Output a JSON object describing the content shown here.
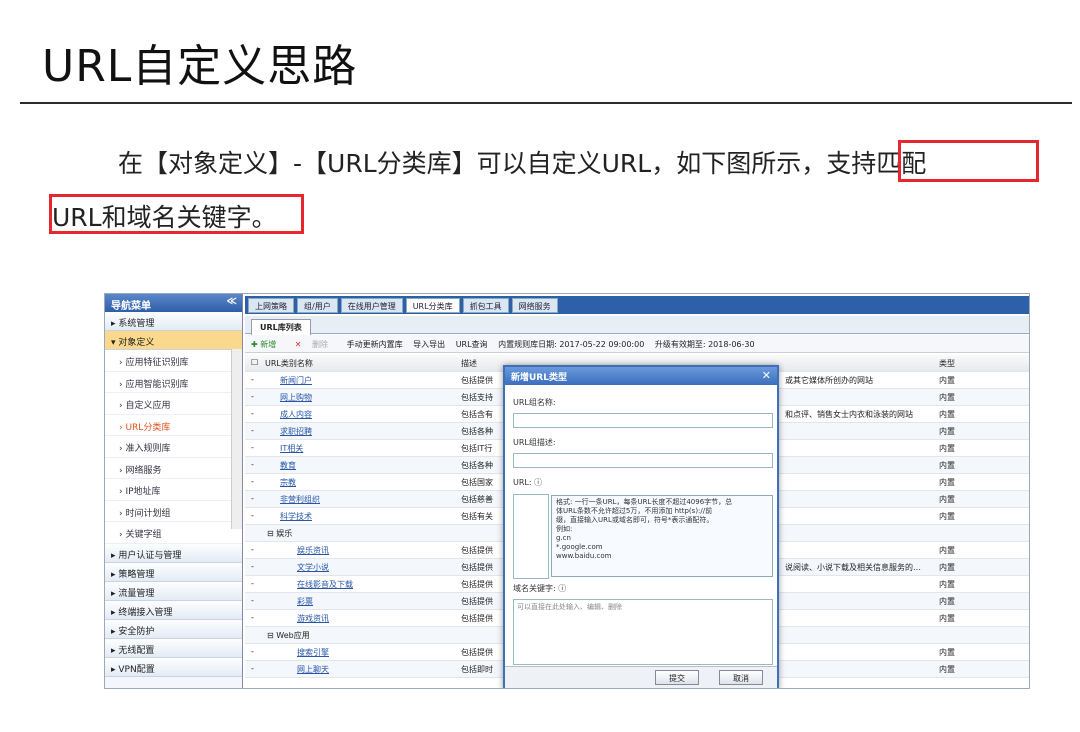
{
  "slide": {
    "title": "URL自定义思路",
    "line1": "在【对象定义】-【URL分类库】可以自定义URL，如下图所示，",
    "line1_hl": "支持匹配",
    "line2": "URL和域名关键字。",
    "accent": "#e8262e"
  },
  "nav": {
    "header": "导航菜单",
    "collapse": "≪",
    "sections_top": [
      "系统管理",
      "对象定义"
    ],
    "items": [
      "应用特征识别库",
      "应用智能识别库",
      "自定义应用",
      "URL分类库",
      "准入规则库",
      "网络服务",
      "IP地址库",
      "时间计划组",
      "关键字组"
    ],
    "sections_bottom": [
      "用户认证与管理",
      "策略管理",
      "流量管理",
      "终端接入管理",
      "安全防护",
      "无线配置",
      "VPN配置"
    ]
  },
  "tabs": [
    "上网策略",
    "组/用户",
    "在线用户管理",
    "URL分类库",
    "抓包工具",
    "网络服务"
  ],
  "subtab": "URL库列表",
  "toolbar": {
    "add": "新增",
    "del": "删除",
    "update": "手动更新内置库",
    "io": "导入导出",
    "query": "URL查询",
    "date": "内置规则库日期: 2017-05-22 09:00:00",
    "expire": "升级有效期至: 2018-06-30"
  },
  "grid": {
    "headers": {
      "name": "URL类别名称",
      "desc": "描述",
      "type": "类型"
    },
    "rows": [
      {
        "name": "新闻门户",
        "desc": "包括提供",
        "right": "或其它媒体所创办的网站",
        "type": "内置"
      },
      {
        "name": "网上购物",
        "desc": "包括支持",
        "right": "",
        "type": "内置"
      },
      {
        "name": "成人内容",
        "desc": "包括含有",
        "right": "和点评、销售女士内衣和泳装的网站",
        "type": "内置"
      },
      {
        "name": "求职招聘",
        "desc": "包括各种",
        "right": "",
        "type": "内置"
      },
      {
        "name": "IT相关",
        "desc": "包括IT行",
        "right": "",
        "type": "内置"
      },
      {
        "name": "教育",
        "desc": "包括各种",
        "right": "",
        "type": "内置"
      },
      {
        "name": "宗教",
        "desc": "包括国家",
        "right": "",
        "type": "内置"
      },
      {
        "name": "非营利组织",
        "desc": "包括慈善",
        "right": "",
        "type": "内置"
      },
      {
        "name": "科学技术",
        "desc": "包括有关",
        "right": "",
        "type": "内置"
      }
    ],
    "group1": "娱乐",
    "rows2": [
      {
        "name": "娱乐资讯",
        "desc": "包括提供",
        "right": "",
        "type": "内置"
      },
      {
        "name": "文学小说",
        "desc": "包括提供",
        "right": "说阅读、小说下载及相关信息服务的…",
        "type": "内置"
      },
      {
        "name": "在线影音及下载",
        "desc": "包括提供",
        "right": "",
        "type": "内置"
      },
      {
        "name": "彩票",
        "desc": "包括提供",
        "right": "",
        "type": "内置"
      },
      {
        "name": "游戏资讯",
        "desc": "包括提供",
        "right": "",
        "type": "内置"
      }
    ],
    "group2": "Web应用",
    "rows3": [
      {
        "name": "搜索引擎",
        "desc": "包括提供",
        "right": "",
        "type": "内置"
      },
      {
        "name": "网上聊天",
        "desc": "包括即时",
        "right": "",
        "type": "内置"
      }
    ]
  },
  "dialog": {
    "title": "新增URL类型",
    "name_label": "URL组名称:",
    "desc_label": "URL组描述:",
    "url_label": "URL: ⓘ",
    "tip_lines": [
      "格式: 一行一条URL，每条URL长度不超过4096字节，总",
      "体URL条数不允许超过5万，不用添加 http(s)://前",
      "缀，直接输入URL或域名即可，符号*表示通配符。",
      "例如:",
      "g.cn",
      "*.google.com",
      "www.baidu.com"
    ],
    "kw_label": "域名关键字: ⓘ",
    "kw_placeholder": "可以直接在此处输入、编辑、删除",
    "submit": "提交",
    "cancel": "取消"
  }
}
